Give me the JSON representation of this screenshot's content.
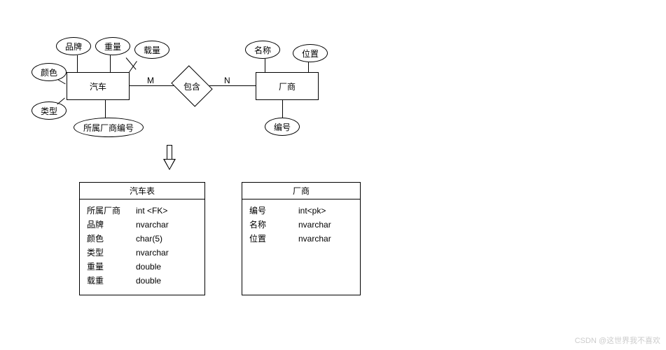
{
  "er": {
    "entities": {
      "car": "汽车",
      "vendor": "厂商"
    },
    "relationship": {
      "name": "包含",
      "left_card": "M",
      "right_card": "N"
    },
    "car_attrs": {
      "brand": "品牌",
      "weight": "重量",
      "load": "载量",
      "color": "颜色",
      "type": "类型",
      "vendor_id": "所属厂商编号"
    },
    "vendor_attrs": {
      "name": "名称",
      "location": "位置",
      "id": "编号"
    }
  },
  "tables": {
    "car": {
      "title": "汽车表",
      "rows": [
        {
          "name": "所属厂商",
          "type": "int  <FK>"
        },
        {
          "name": "品牌",
          "type": "nvarchar"
        },
        {
          "name": "颜色",
          "type": "char(5)"
        },
        {
          "name": "类型",
          "type": "nvarchar"
        },
        {
          "name": "重量",
          "type": "double"
        },
        {
          "name": "载重",
          "type": "double"
        }
      ]
    },
    "vendor": {
      "title": "厂商",
      "rows": [
        {
          "name": "编号",
          "type": "int<pk>"
        },
        {
          "name": "名称",
          "type": "nvarchar"
        },
        {
          "name": "位置",
          "type": "nvarchar"
        }
      ]
    }
  },
  "watermark": "CSDN @这世界我不喜欢",
  "chart_data": {
    "type": "er-diagram",
    "entities": [
      {
        "name": "汽车",
        "attributes": [
          "品牌",
          "重量",
          "载量",
          "颜色",
          "类型",
          "所属厂商编号"
        ]
      },
      {
        "name": "厂商",
        "attributes": [
          "名称",
          "位置",
          "编号"
        ]
      }
    ],
    "relationships": [
      {
        "name": "包含",
        "from": "汽车",
        "to": "厂商",
        "cardinality": [
          "M",
          "N"
        ]
      }
    ],
    "relational_schema": [
      {
        "table": "汽车表",
        "columns": [
          {
            "name": "所属厂商",
            "type": "int",
            "key": "FK"
          },
          {
            "name": "品牌",
            "type": "nvarchar"
          },
          {
            "name": "颜色",
            "type": "char(5)"
          },
          {
            "name": "类型",
            "type": "nvarchar"
          },
          {
            "name": "重量",
            "type": "double"
          },
          {
            "name": "载重",
            "type": "double"
          }
        ]
      },
      {
        "table": "厂商",
        "columns": [
          {
            "name": "编号",
            "type": "int",
            "key": "PK"
          },
          {
            "name": "名称",
            "type": "nvarchar"
          },
          {
            "name": "位置",
            "type": "nvarchar"
          }
        ]
      }
    ]
  }
}
